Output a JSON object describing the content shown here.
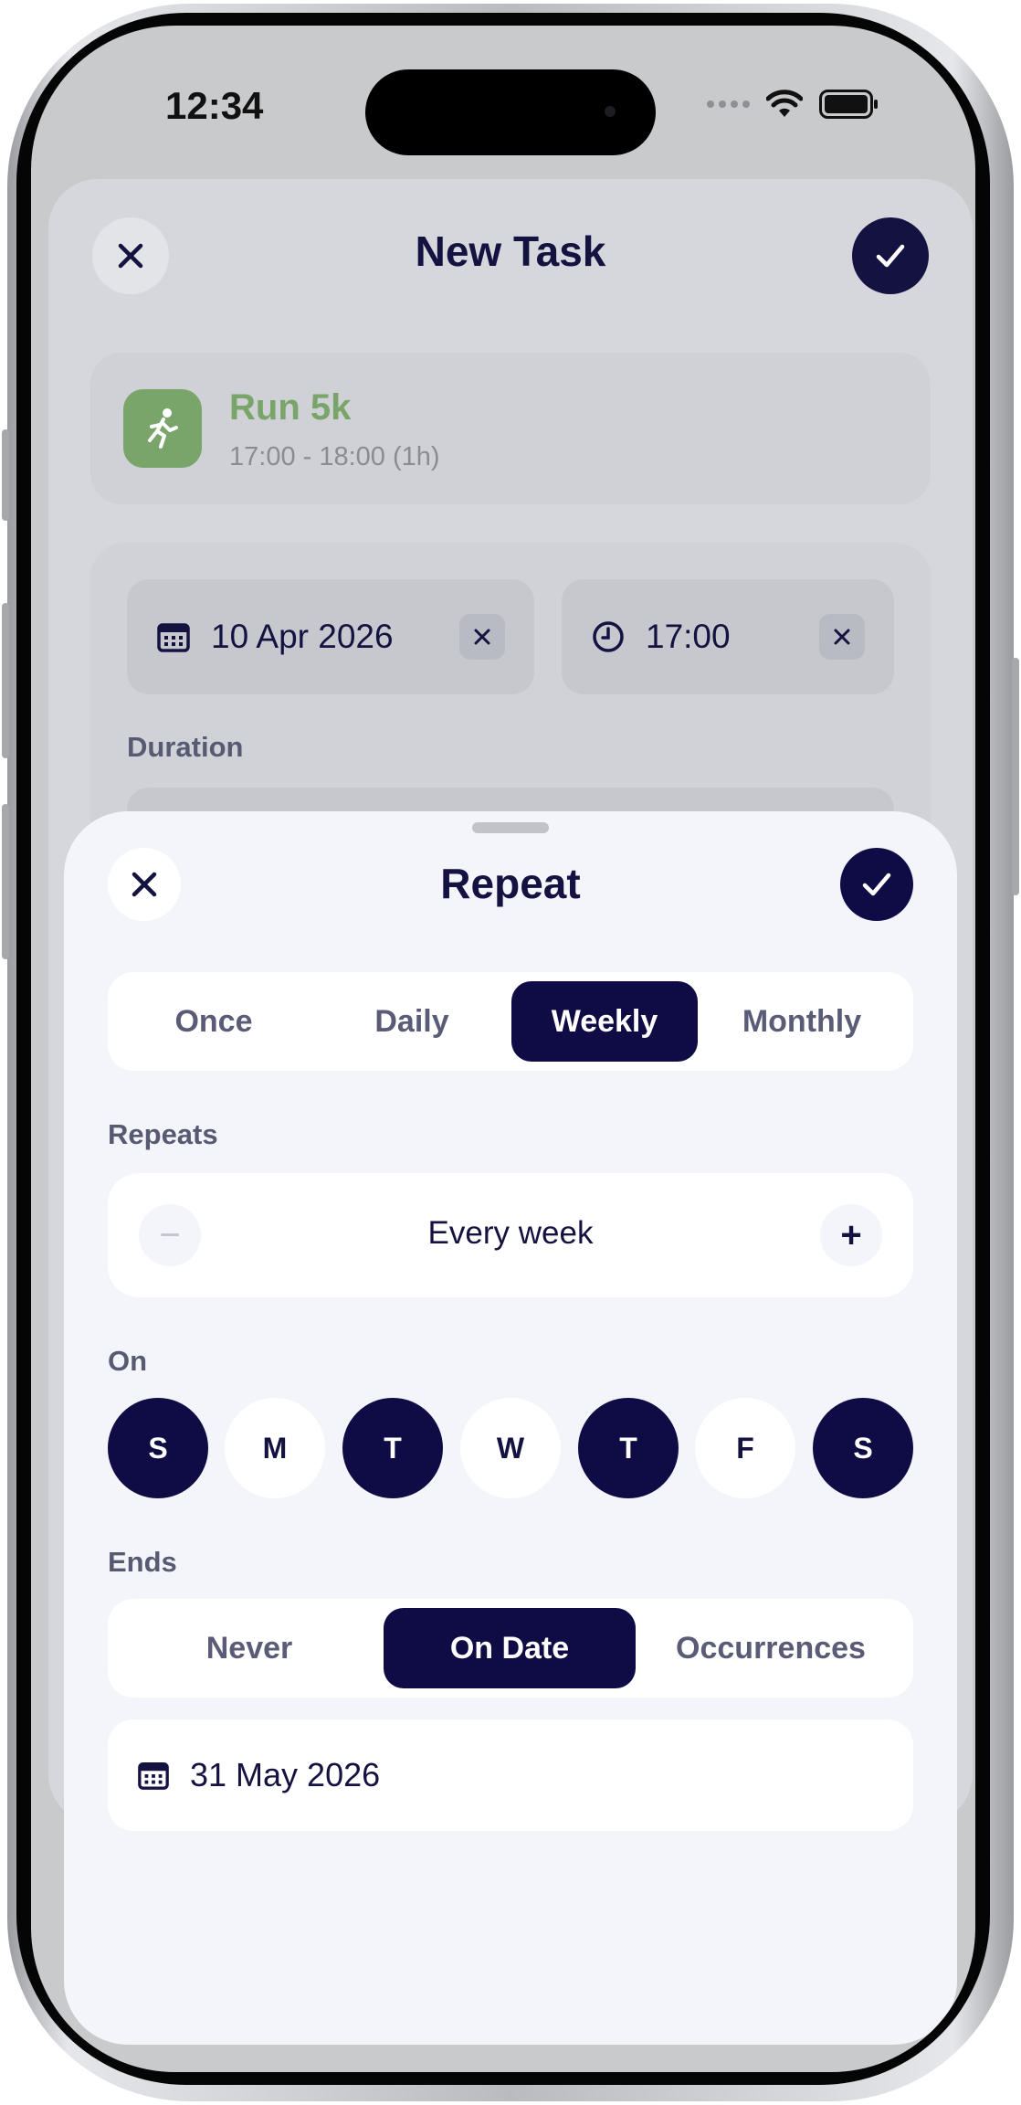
{
  "status_bar": {
    "time": "12:34"
  },
  "background_screen": {
    "title": "New Task",
    "task": {
      "name": "Run 5k",
      "time_range": "17:00 - 18:00 (1h)",
      "icon": "running-person-icon",
      "color": "#7aa56a"
    },
    "date_value": "10 Apr 2026",
    "time_value": "17:00",
    "duration_label": "Duration"
  },
  "repeat_sheet": {
    "title": "Repeat",
    "frequency_options": [
      {
        "label": "Once",
        "selected": false
      },
      {
        "label": "Daily",
        "selected": false
      },
      {
        "label": "Weekly",
        "selected": true
      },
      {
        "label": "Monthly",
        "selected": false
      }
    ],
    "repeats_label": "Repeats",
    "interval": {
      "value_text": "Every week",
      "minus": "−",
      "plus": "+"
    },
    "on_label": "On",
    "days": [
      {
        "label": "S",
        "selected": true
      },
      {
        "label": "M",
        "selected": false
      },
      {
        "label": "T",
        "selected": true
      },
      {
        "label": "W",
        "selected": false
      },
      {
        "label": "T",
        "selected": true
      },
      {
        "label": "F",
        "selected": false
      },
      {
        "label": "S",
        "selected": true
      }
    ],
    "ends_label": "Ends",
    "end_options": [
      {
        "label": "Never",
        "selected": false
      },
      {
        "label": "On Date",
        "selected": true
      },
      {
        "label": "Occurrences",
        "selected": false
      }
    ],
    "end_date": "31 May 2026"
  },
  "colors": {
    "accent": "#0f0c45",
    "sheet_bg": "#f4f5fb",
    "label": "#575a72"
  }
}
